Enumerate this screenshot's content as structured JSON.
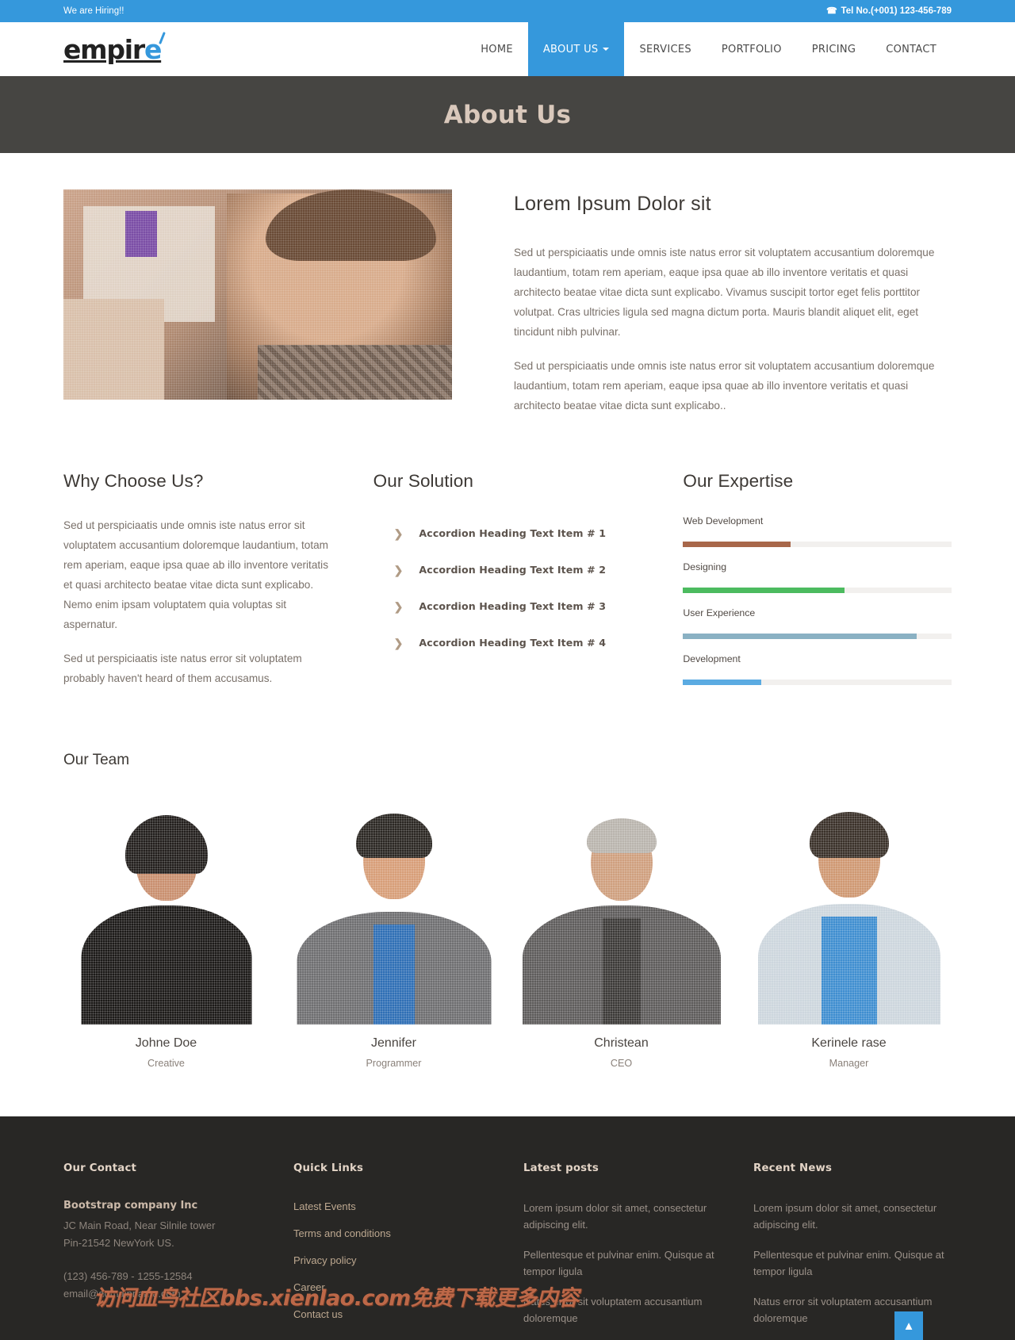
{
  "topbar": {
    "hiring_text": "We are Hiring!!",
    "phone_icon": "phone-icon",
    "tel_text": "Tel No.(+001) 123-456-789",
    "accent_color": "#3598dc"
  },
  "header": {
    "logo_main": "empir",
    "logo_accent": "e",
    "nav": [
      {
        "label": "HOME",
        "active": false,
        "caret": false
      },
      {
        "label": "ABOUT US",
        "active": true,
        "caret": true
      },
      {
        "label": "SERVICES",
        "active": false,
        "caret": false
      },
      {
        "label": "PORTFOLIO",
        "active": false,
        "caret": false
      },
      {
        "label": "PRICING",
        "active": false,
        "caret": false
      },
      {
        "label": "CONTACT",
        "active": false,
        "caret": false
      }
    ]
  },
  "hero": {
    "title": "About Us",
    "bg_color": "#464542",
    "title_color": "#d9c8bb"
  },
  "intro": {
    "image_name": "team-working-photo",
    "heading": "Lorem Ipsum Dolor sit",
    "paragraph1": "Sed ut perspiciaatis unde omnis iste natus error sit voluptatem accusantium doloremque laudantium, totam rem aperiam, eaque ipsa quae ab illo inventore veritatis et quasi architecto beatae vitae dicta sunt explicabo. Vivamus suscipit tortor eget felis porttitor volutpat. Cras ultricies ligula sed magna dictum porta. Mauris blandit aliquet elit, eget tincidunt nibh pulvinar.",
    "paragraph2": "Sed ut perspiciaatis unde omnis iste natus error sit voluptatem accusantium doloremque laudantium, totam rem aperiam, eaque ipsa quae ab illo inventore veritatis et quasi architecto beatae vitae dicta sunt explicabo.."
  },
  "why_choose": {
    "heading": "Why Choose Us?",
    "paragraph1": "Sed ut perspiciaatis unde omnis iste natus error sit voluptatem accusantium doloremque laudantium, totam rem aperiam, eaque ipsa quae ab illo inventore veritatis et quasi architecto beatae vitae dicta sunt explicabo. Nemo enim ipsam voluptatem quia voluptas sit aspernatur.",
    "paragraph2": "Sed ut perspiciaatis iste natus error sit voluptatem probably haven't heard of them accusamus."
  },
  "our_solution": {
    "heading": "Our Solution",
    "items": [
      {
        "label": "Accordion Heading Text Item # 1",
        "icon": "chevron-right-icon"
      },
      {
        "label": "Accordion Heading Text Item # 2",
        "icon": "chevron-right-icon"
      },
      {
        "label": "Accordion Heading Text Item # 3",
        "icon": "chevron-right-icon"
      },
      {
        "label": "Accordion Heading Text Item # 4",
        "icon": "chevron-right-icon"
      }
    ]
  },
  "our_expertise": {
    "heading": "Our Expertise",
    "skills": [
      {
        "name": "Web Development",
        "percent": 40,
        "color": "#a8674a",
        "style": "solid"
      },
      {
        "name": "Designing",
        "percent": 60,
        "color": "#4cbb5f",
        "style": "solid"
      },
      {
        "name": "User Experience",
        "percent": 87,
        "color": "#6f9fb5",
        "style": "dotted"
      },
      {
        "name": "Development",
        "percent": 29,
        "color": "#3598dc",
        "style": "dotted"
      }
    ]
  },
  "our_team": {
    "heading": "Our Team",
    "members": [
      {
        "name": "Johne Doe",
        "role": "Creative",
        "photo_name": "team-photo-johne-doe"
      },
      {
        "name": "Jennifer",
        "role": "Programmer",
        "photo_name": "team-photo-jennifer"
      },
      {
        "name": "Christean",
        "role": "CEO",
        "photo_name": "team-photo-christean"
      },
      {
        "name": "Kerinele rase",
        "role": "Manager",
        "photo_name": "team-photo-kerinele-rase"
      }
    ]
  },
  "footer": {
    "contact": {
      "heading": "Our Contact",
      "company": "Bootstrap company Inc",
      "address_line1": "JC Main Road, Near Silnile tower",
      "address_line2": "Pin-21542 NewYork US.",
      "phone": "(123) 456-789 - 1255-12584",
      "email": "email@domainname.com"
    },
    "quick_links": {
      "heading": "Quick Links",
      "links": [
        "Latest Events",
        "Terms and conditions",
        "Privacy policy",
        "Career",
        "Contact us"
      ]
    },
    "latest_posts": {
      "heading": "Latest posts",
      "posts": [
        "Lorem ipsum dolor sit amet, consectetur adipiscing elit.",
        "Pellentesque et pulvinar enim. Quisque at tempor ligula",
        "Natus error sit voluptatem accusantium doloremque"
      ]
    },
    "recent_news": {
      "heading": "Recent News",
      "posts": [
        "Lorem ipsum dolor sit amet, consectetur adipiscing elit.",
        "Pellentesque et pulvinar enim. Quisque at tempor ligula",
        "Natus error sit voluptatem accusantium doloremque"
      ]
    },
    "watermark": "访问血鸟社区bbs.xienlao.com免费下载更多内容",
    "to_top_icon": "chevron-up-icon",
    "bg_color": "#282725"
  }
}
